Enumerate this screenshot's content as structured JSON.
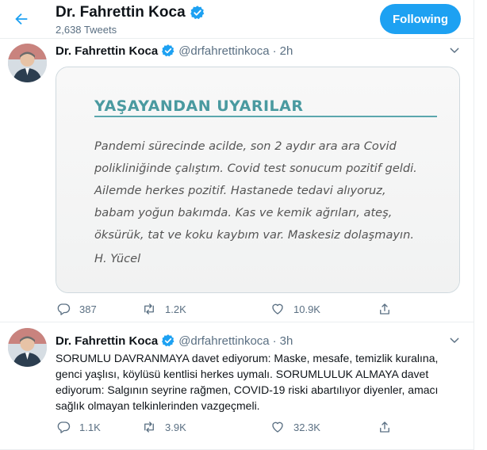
{
  "colors": {
    "accent": "#1da1f2",
    "secondary_text": "#5b7083",
    "card_heading": "#4a9aa0"
  },
  "header": {
    "back_icon": "arrow-left-icon",
    "title": "Dr. Fahrettin Koca",
    "verified_icon": "verified-badge-icon",
    "tweet_count": "2,638 Tweets",
    "follow_label": "Following"
  },
  "tweets": [
    {
      "name": "Dr. Fahrettin Koca",
      "handle": "@drfahrettinkoca",
      "separator": "·",
      "time": "2h",
      "media": {
        "heading": "YAŞAYANDAN UYARILAR",
        "body": "Pandemi sürecinde acilde, son 2 aydır ara ara Covid polikliniğinde çalıştım. Covid test sonucum pozitif geldi. Ailemde herkes pozitif. Hastanede tedavi alıyoruz, babam yoğun bakımda. Kas ve kemik ağrıları, ateş, öksürük, tat ve koku kaybım var. Maskesiz dolaşmayın.",
        "signature": "H. Yücel"
      },
      "actions": {
        "replies": "387",
        "retweets": "1.2K",
        "likes": "10.9K"
      }
    },
    {
      "name": "Dr. Fahrettin Koca",
      "handle": "@drfahrettinkoca",
      "separator": "·",
      "time": "3h",
      "text": "SORUMLU DAVRANMAYA davet ediyorum: Maske, mesafe, temizlik kuralına, genci yaşlısı, köylüsü kentlisi herkes uymalı. SORUMLULUK ALMAYA davet ediyorum: Salgının seyrine rağmen, COVID-19 riski abartılıyor diyenler, amacı sağlık olmayan telkinlerinden vazgeçmeli.",
      "actions": {
        "replies": "1.1K",
        "retweets": "3.9K",
        "likes": "32.3K"
      }
    }
  ]
}
